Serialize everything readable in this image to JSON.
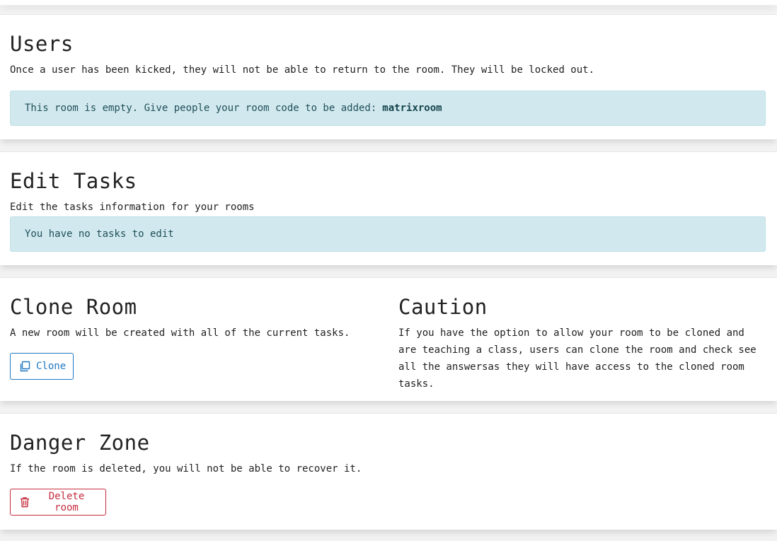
{
  "users": {
    "title": "Users",
    "description": "Once a user has been kicked, they will not be able to return to the room. They will be locked out.",
    "empty_alert": {
      "text": "This room is empty. Give people your room code to be added:",
      "room_code": "matrixroom"
    }
  },
  "edit_tasks": {
    "title": "Edit Tasks",
    "description": "Edit the tasks information for your rooms",
    "empty_alert": "You have no tasks to edit"
  },
  "clone_room": {
    "title": "Clone Room",
    "description": "A new room will be created with all of the current tasks.",
    "button_label": "Clone",
    "button_icon": "copy-icon"
  },
  "caution": {
    "title": "Caution",
    "text": "If you have the option to allow your room to be cloned and are teaching a class, users can clone the room and check see all the answersas they will have access to the cloned room tasks."
  },
  "danger_zone": {
    "title": "Danger Zone",
    "description": "If the room is deleted, you will not be able to recover it.",
    "button_label": "Delete room",
    "button_icon": "trash-icon"
  },
  "colors": {
    "alert_bg": "#d1e9ee",
    "primary": "#1f78c1",
    "danger": "#c52b3d"
  }
}
